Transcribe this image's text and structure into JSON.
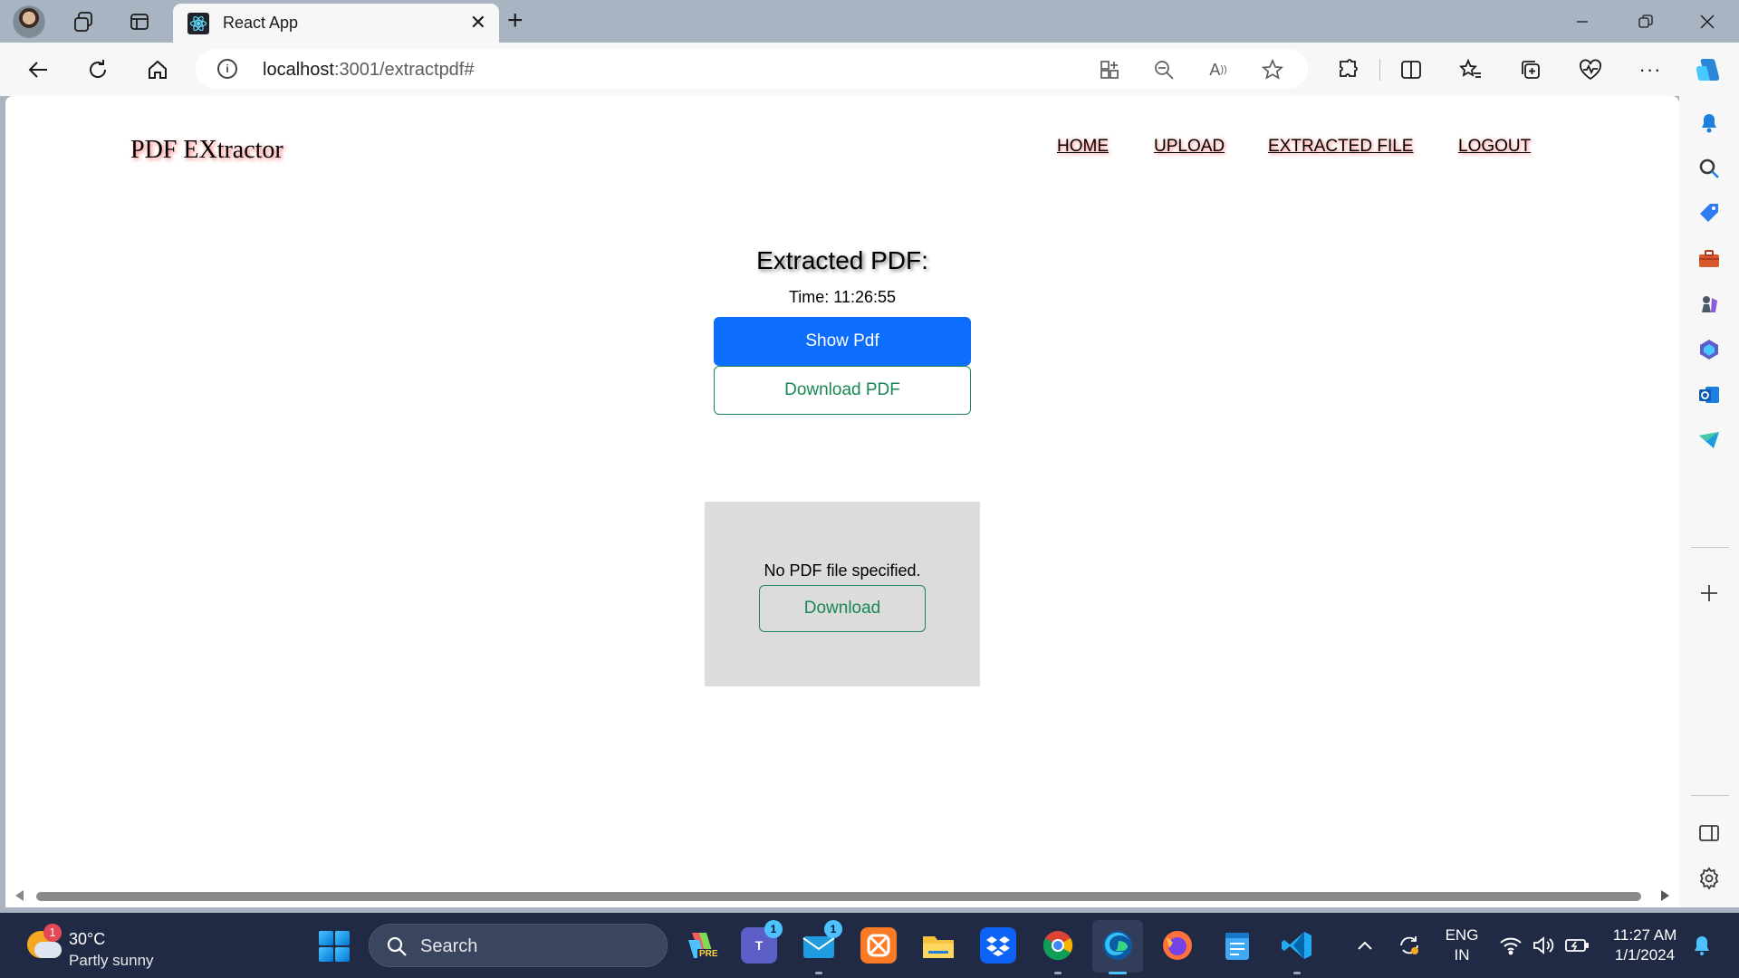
{
  "browser": {
    "tab_title": "React App",
    "url_host": "localhost",
    "url_rest": ":3001/extractpdf#"
  },
  "page": {
    "brand": "PDF EXtractor",
    "nav": [
      "HOME",
      "UPLOAD",
      "EXTRACTED FILE",
      "LOGOUT"
    ],
    "heading": "Extracted PDF:",
    "time_text": "Time: 11:26:55",
    "show_pdf_label": "Show Pdf",
    "download_pdf_label": "Download PDF",
    "no_file_message": "No PDF file specified.",
    "download_label": "Download"
  },
  "taskbar": {
    "weather_temp": "30°C",
    "weather_condition": "Partly sunny",
    "weather_badge": "1",
    "search_label": "Search",
    "teams_badge": "1",
    "mail_badge": "1",
    "lang_top": "ENG",
    "lang_bottom": "IN",
    "clock_time": "11:27 AM",
    "clock_date": "1/1/2024",
    "copilot_tag": "PRE"
  },
  "colors": {
    "primary": "#0d6efd",
    "success": "#198754",
    "taskbar": "#202a44"
  }
}
